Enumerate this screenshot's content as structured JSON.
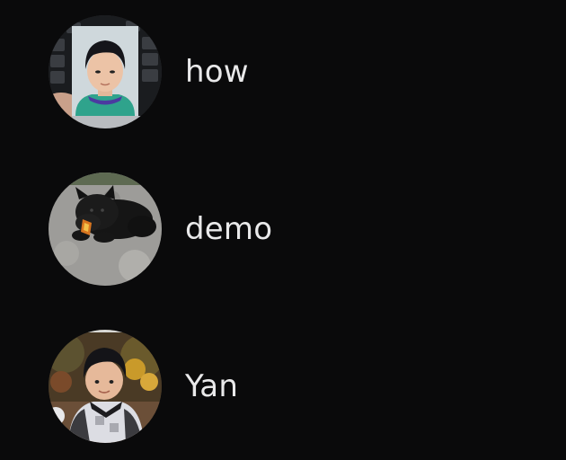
{
  "accounts": [
    {
      "name": "how",
      "avatar_icon": "avatar-photo-child-id-portrait",
      "avatar_colors": {
        "background": "#c9ccd0",
        "accent": "#3a2f6b"
      }
    },
    {
      "name": "demo",
      "avatar_icon": "avatar-photo-black-dog",
      "avatar_colors": {
        "background": "#9a9a98",
        "accent": "#1b1b1b"
      }
    },
    {
      "name": "Yan",
      "avatar_icon": "avatar-photo-child-outdoors",
      "avatar_colors": {
        "background": "#5b4b2f",
        "accent": "#d9d9df"
      }
    }
  ],
  "theme": {
    "background": "#0a0a0b",
    "text": "#e9e9ea"
  }
}
